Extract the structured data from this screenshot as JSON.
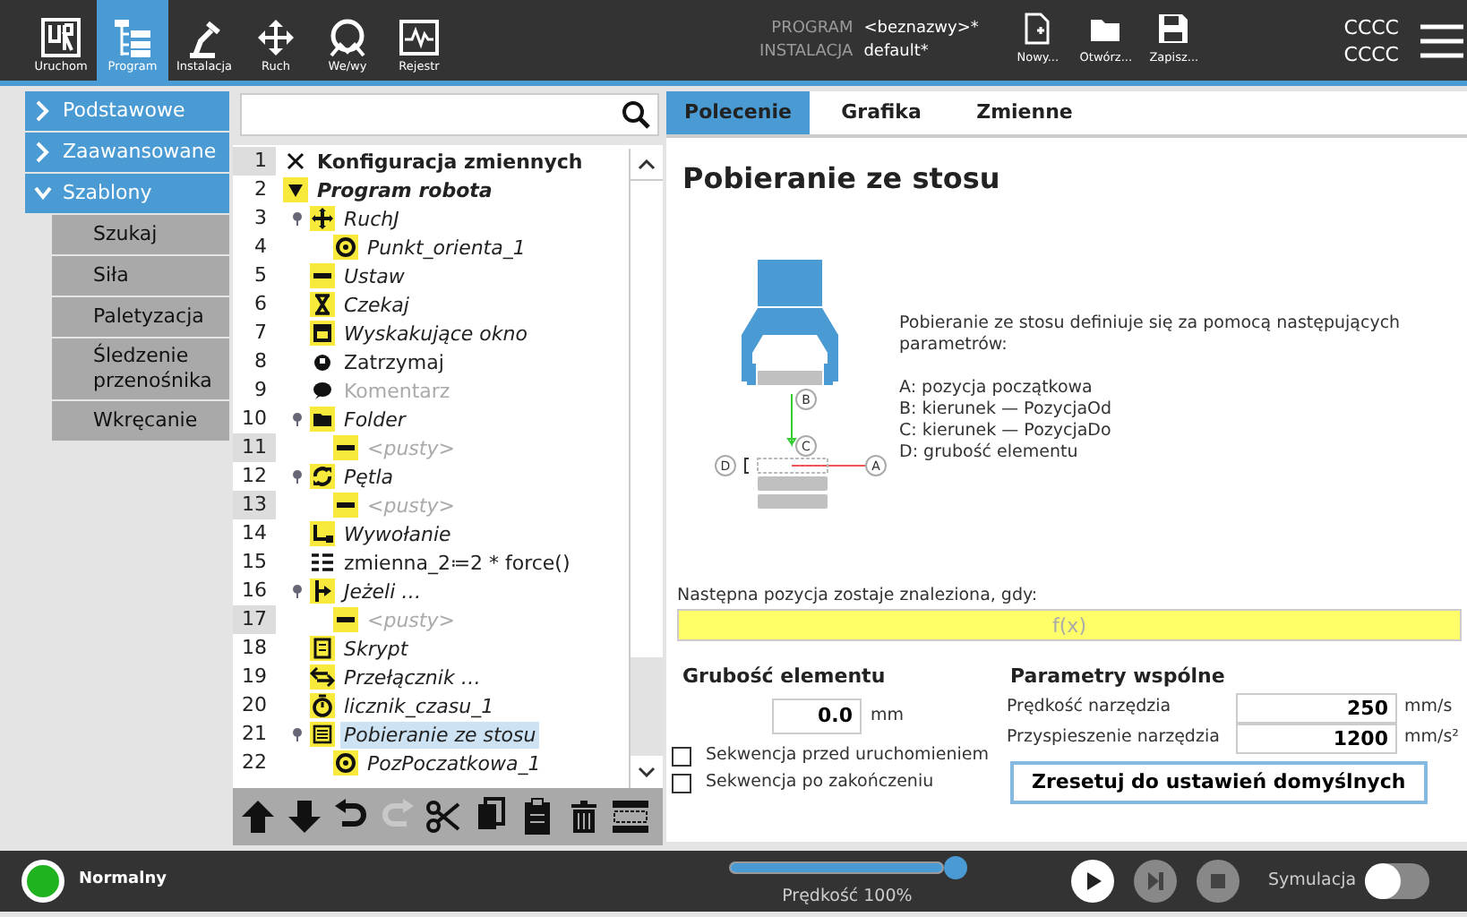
{
  "top_bar": {
    "nav": [
      {
        "label": "Uruchom",
        "kind": "run",
        "selected": false
      },
      {
        "label": "Program",
        "kind": "program",
        "selected": true
      },
      {
        "label": "Instalacja",
        "kind": "install",
        "selected": false
      },
      {
        "label": "Ruch",
        "kind": "move",
        "selected": false
      },
      {
        "label": "We/wy",
        "kind": "io",
        "selected": false
      },
      {
        "label": "Rejestr",
        "kind": "log",
        "selected": false
      }
    ],
    "program_label": "PROGRAM",
    "program_value": "<beznazwy>*",
    "installation_label": "INSTALACJA",
    "installation_value": "default*",
    "file_buttons": [
      {
        "label": "Nowy...",
        "kind": "new"
      },
      {
        "label": "Otwórz...",
        "kind": "open"
      },
      {
        "label": "Zapisz...",
        "kind": "save"
      }
    ],
    "user_lines": [
      "CCCC",
      "CCCC"
    ]
  },
  "categories": [
    {
      "label": "Podstawowe",
      "expanded": false
    },
    {
      "label": "Zaawansowane",
      "expanded": false
    },
    {
      "label": "Szablony",
      "expanded": true,
      "children": [
        "Szukaj",
        "Siła",
        "Paletyzacja",
        "Śledzenie przenośnika",
        "Wkręcanie"
      ]
    }
  ],
  "program_tree": {
    "rows": [
      {
        "number": "1",
        "text": "Konfiguracja zmiennych",
        "kind": "variables",
        "bold": true,
        "italic": false,
        "disabled": false,
        "number_highlighted": true,
        "selected": false
      },
      {
        "number": "2",
        "text": "Program robota",
        "kind": "program",
        "bold": true,
        "italic": true,
        "disabled": false,
        "number_highlighted": false,
        "selected": false,
        "children": [
          {
            "number": "3",
            "text": "RuchJ",
            "kind": "move",
            "bold": false,
            "italic": true,
            "disabled": false,
            "number_highlighted": false,
            "selected": false,
            "children": [
              {
                "number": "4",
                "text": "Punkt_orienta_1",
                "kind": "waypoint",
                "bold": false,
                "italic": true,
                "disabled": false,
                "number_highlighted": false,
                "selected": false
              }
            ]
          },
          {
            "number": "5",
            "text": "Ustaw",
            "kind": "set",
            "bold": false,
            "italic": true,
            "disabled": false,
            "number_highlighted": false,
            "selected": false
          },
          {
            "number": "6",
            "text": "Czekaj",
            "kind": "wait",
            "bold": false,
            "italic": true,
            "disabled": false,
            "number_highlighted": false,
            "selected": false
          },
          {
            "number": "7",
            "text": "Wyskakujące okno",
            "kind": "popup",
            "bold": false,
            "italic": true,
            "disabled": false,
            "number_highlighted": false,
            "selected": false
          },
          {
            "number": "8",
            "text": "Zatrzymaj",
            "kind": "halt",
            "bold": false,
            "italic": false,
            "disabled": false,
            "number_highlighted": false,
            "selected": false
          },
          {
            "number": "9",
            "text": "Komentarz",
            "kind": "comment",
            "bold": false,
            "italic": false,
            "disabled": true,
            "number_highlighted": false,
            "selected": false
          },
          {
            "number": "10",
            "text": "Folder",
            "kind": "folder",
            "bold": false,
            "italic": true,
            "disabled": false,
            "number_highlighted": false,
            "selected": false,
            "children": [
              {
                "number": "11",
                "text": "<pusty>",
                "kind": "empty",
                "bold": false,
                "italic": true,
                "disabled": true,
                "number_highlighted": true,
                "selected": false
              }
            ]
          },
          {
            "number": "12",
            "text": "Pętla",
            "kind": "loop",
            "bold": false,
            "italic": true,
            "disabled": false,
            "number_highlighted": false,
            "selected": false,
            "children": [
              {
                "number": "13",
                "text": "<pusty>",
                "kind": "empty",
                "bold": false,
                "italic": true,
                "disabled": true,
                "number_highlighted": true,
                "selected": false
              }
            ]
          },
          {
            "number": "14",
            "text": "Wywołanie",
            "kind": "call",
            "bold": false,
            "italic": true,
            "disabled": false,
            "number_highlighted": false,
            "selected": false
          },
          {
            "number": "15",
            "text": "zmienna_2≔2 * force()",
            "kind": "assignment",
            "bold": false,
            "italic": false,
            "disabled": false,
            "number_highlighted": false,
            "selected": false
          },
          {
            "number": "16",
            "text": "Jeżeli …",
            "kind": "if",
            "bold": false,
            "italic": true,
            "disabled": false,
            "number_highlighted": false,
            "selected": false,
            "children": [
              {
                "number": "17",
                "text": "<pusty>",
                "kind": "empty",
                "bold": false,
                "italic": true,
                "disabled": true,
                "number_highlighted": true,
                "selected": false
              }
            ]
          },
          {
            "number": "18",
            "text": "Skrypt",
            "kind": "script",
            "bold": false,
            "italic": true,
            "disabled": false,
            "number_highlighted": false,
            "selected": false
          },
          {
            "number": "19",
            "text": "Przełącznik …",
            "kind": "switch",
            "bold": false,
            "italic": true,
            "disabled": false,
            "number_highlighted": false,
            "selected": false
          },
          {
            "number": "20",
            "text": "licznik_czasu_1",
            "kind": "timer",
            "bold": false,
            "italic": true,
            "disabled": false,
            "number_highlighted": false,
            "selected": false
          },
          {
            "number": "21",
            "text": "Pobieranie ze stosu",
            "kind": "stack",
            "bold": false,
            "italic": true,
            "disabled": false,
            "number_highlighted": false,
            "selected": true,
            "children": [
              {
                "number": "22",
                "text": "PozPoczatkowa_1",
                "kind": "waypoint",
                "bold": false,
                "italic": true,
                "disabled": false,
                "number_highlighted": false,
                "selected": false
              }
            ]
          }
        ]
      }
    ]
  },
  "toolbar": [
    {
      "kind": "up",
      "disabled": false
    },
    {
      "kind": "down",
      "disabled": false
    },
    {
      "kind": "undo",
      "disabled": false
    },
    {
      "kind": "redo",
      "disabled": true
    },
    {
      "kind": "cut",
      "disabled": false
    },
    {
      "kind": "copy",
      "disabled": false
    },
    {
      "kind": "paste",
      "disabled": false
    },
    {
      "kind": "delete",
      "disabled": false
    },
    {
      "kind": "suppress",
      "disabled": false
    }
  ],
  "command_panel": {
    "tabs": [
      {
        "label": "Polecenie",
        "selected": true
      },
      {
        "label": "Grafika",
        "selected": false
      },
      {
        "label": "Zmienne",
        "selected": false
      }
    ],
    "title": "Pobieranie ze stosu",
    "diagram_labels": [
      "B",
      "C",
      "D",
      "A"
    ],
    "description": "Pobieranie ze stosu definiuje się za pomocą następujących parametrów:",
    "legend": [
      "A: pozycja początkowa",
      "B: kierunek — PozycjaOd",
      "C: kierunek — PozycjaDo",
      "D: grubość elementu"
    ],
    "condition_label": "Następna pozycja zostaje znaleziona, gdy:",
    "condition_field": {
      "placeholder": "f(x)"
    },
    "thickness": {
      "title": "Grubość elementu",
      "value": "0.0",
      "unit": "mm"
    },
    "options": [
      {
        "label": "Sekwencja przed uruchomieniem",
        "checked": false
      },
      {
        "label": "Sekwencja po zakończeniu",
        "checked": false
      }
    ],
    "common": {
      "title": "Parametry wspólne",
      "params": [
        {
          "label": "Prędkość narzędzia",
          "value": "250",
          "unit": "mm/s"
        },
        {
          "label": "Przyspieszenie narzędzia",
          "value": "1200",
          "unit": "mm/s²"
        }
      ]
    },
    "reset_button": "Zresetuj do ustawień domyślnych"
  },
  "status_bar": {
    "status": {
      "label": "Normalny",
      "color": "#1fb31f"
    },
    "speed": {
      "level": 1.0,
      "reading": "Prędkość 100%"
    },
    "controls": [
      {
        "kind": "play",
        "disabled": false
      },
      {
        "kind": "step",
        "disabled": true
      },
      {
        "kind": "stop",
        "disabled": true
      }
    ],
    "simulation": {
      "label": "Symulacja",
      "on": false
    }
  }
}
